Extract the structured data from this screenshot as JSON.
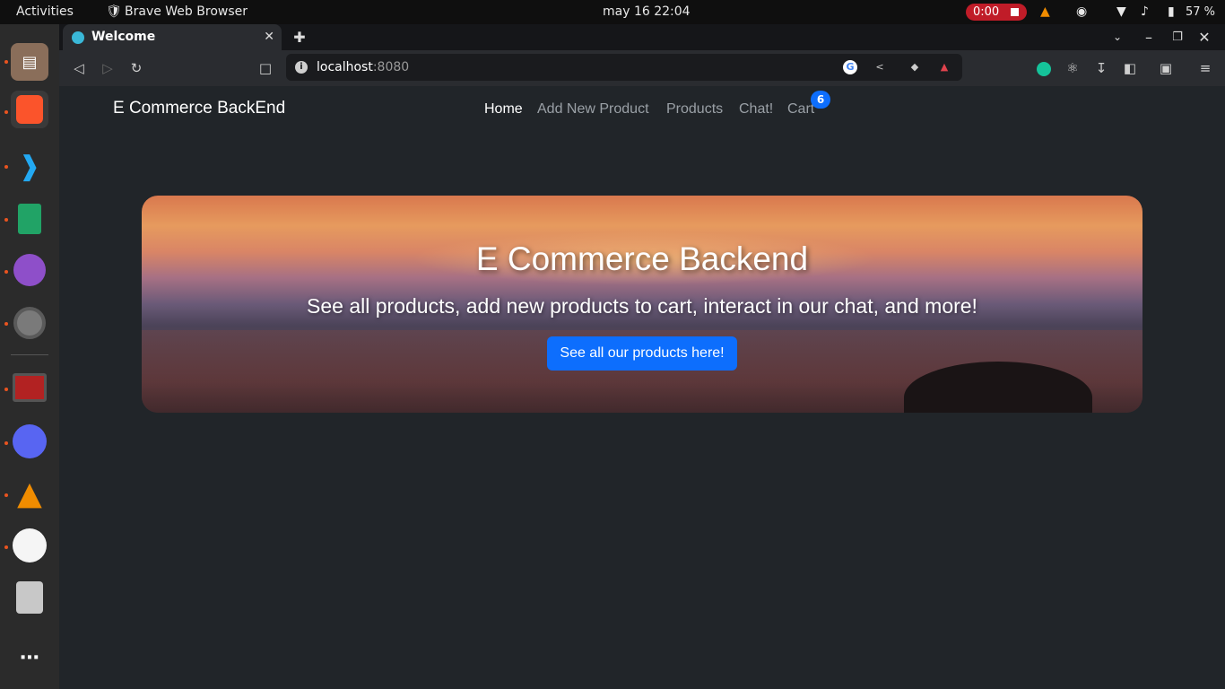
{
  "system_bar": {
    "activities": "Activities",
    "app_name": "Brave Web Browser",
    "clock": "may 16  22:04",
    "recording": "0:00",
    "battery": "57 %"
  },
  "browser": {
    "tab_title": "Welcome",
    "url_host": "localhost",
    "url_port": ":8080"
  },
  "page": {
    "brand": "E Commerce BackEnd",
    "nav": [
      "Home",
      "Add New Product",
      "Products",
      "Chat!",
      "Cart"
    ],
    "cart_count": "6",
    "hero_title": "E Commerce Backend",
    "hero_subtitle": "See all products, add new products to cart, interact in our chat, and more!",
    "hero_button": "See all our products here!"
  },
  "colors": {
    "primary": "#0d6efd",
    "page_bg": "#212529",
    "recording": "#c01c28"
  }
}
